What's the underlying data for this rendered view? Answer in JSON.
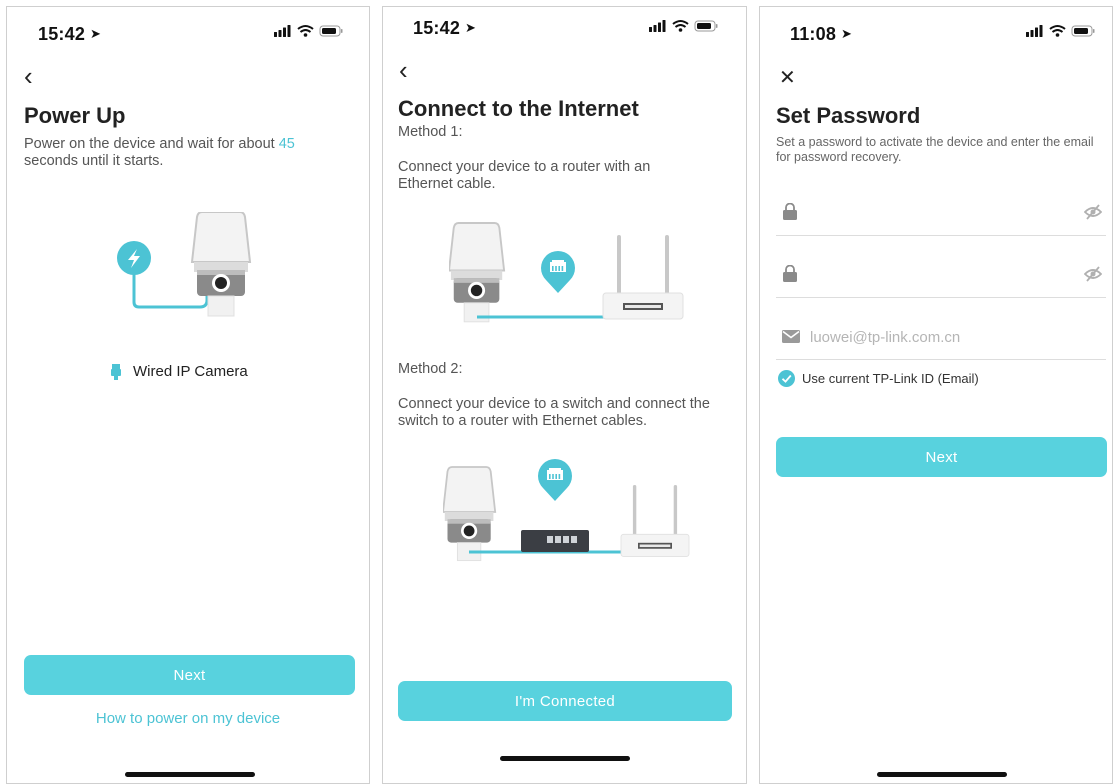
{
  "screens": [
    {
      "status": {
        "time": "15:42"
      },
      "title": "Power Up",
      "description_prefix": "Power on the device and wait for about",
      "description_highlight": "45",
      "description_suffix": "seconds until it starts.",
      "device_label": "Wired IP Camera",
      "next_label": "Next",
      "help_link": "How to power on my device"
    },
    {
      "status": {
        "time": "15:42"
      },
      "title": "Connect to the Internet",
      "method1_title": "Method 1:",
      "method1_text": "Connect your device to a router with an Ethernet cable.",
      "method2_title": "Method 2:",
      "method2_text": "Connect your device to a switch and connect the switch to a router with Ethernet cables.",
      "connected_label": "I'm Connected"
    },
    {
      "status": {
        "time": "11:08"
      },
      "title": "Set Password",
      "description": "Set a password to activate the device and enter the email for password recovery.",
      "email_placeholder": "luowei@tp-link.com.cn",
      "use_id_label": "Use current TP-Link ID (Email)",
      "next_label": "Next"
    }
  ],
  "colors": {
    "accent": "#58d2de",
    "link": "#4cc3d4",
    "text": "#222222"
  },
  "icons": [
    "location-arrow-icon",
    "signal-icon",
    "wifi-icon",
    "battery-icon",
    "back-chevron-icon",
    "close-icon",
    "lock-icon",
    "eye-off-icon",
    "mail-icon",
    "check-icon",
    "ethernet-port-icon",
    "lightning-icon",
    "camera-illustration",
    "router-illustration",
    "switch-illustration"
  ]
}
